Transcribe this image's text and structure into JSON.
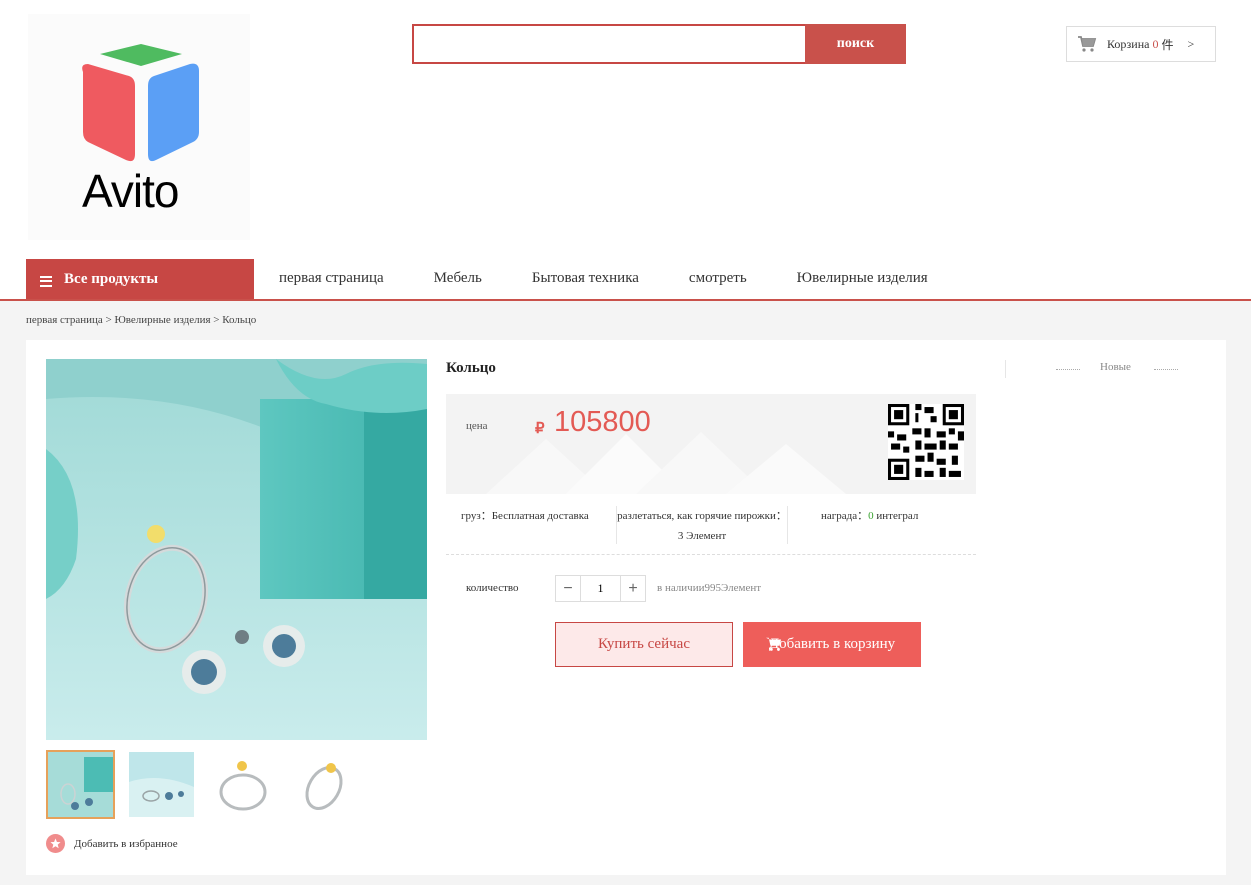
{
  "brand": {
    "name": "Avito"
  },
  "search": {
    "placeholder": "",
    "button_label": "поиск"
  },
  "cart": {
    "label": "Корзина",
    "count": "0",
    "unit": "件",
    "arrow": ">"
  },
  "nav": {
    "all_products": "Все продукты",
    "links": [
      "первая страница",
      "Мебель",
      "Бытовая техника",
      "смотреть",
      "Ювелирные изделия"
    ]
  },
  "breadcrumb": "первая страница > Ювелирные изделия > Кольцо",
  "product": {
    "title": "Кольцо",
    "price_label": "цена",
    "currency": "₽",
    "price": "105800",
    "shipping_label": "груз：",
    "shipping_value": "Бесплатная доставка",
    "sold_label": "разлетаться, как горячие пирожки：",
    "sold_value": "3 Элемент",
    "reward_label": "награда：",
    "reward_value": "0",
    "reward_unit": " интеграл",
    "quantity_label": "количество",
    "quantity": "1",
    "stock": "в наличии995Элемент",
    "buy_now": "Купить сейчас",
    "add_to_cart": "Добавить в корзину",
    "favorite": "Добавить в избранное"
  },
  "side": {
    "label": "Новые"
  },
  "colors": {
    "accent": "#c74744",
    "price": "#e35a54",
    "cart_button": "#ee5e5a",
    "reward": "#3aa330"
  },
  "icons": {
    "logo": "avito-cube-logo",
    "cart": "cart-icon",
    "menu": "menu-icon",
    "qr": "qr-code-icon",
    "favorite": "star-icon"
  }
}
